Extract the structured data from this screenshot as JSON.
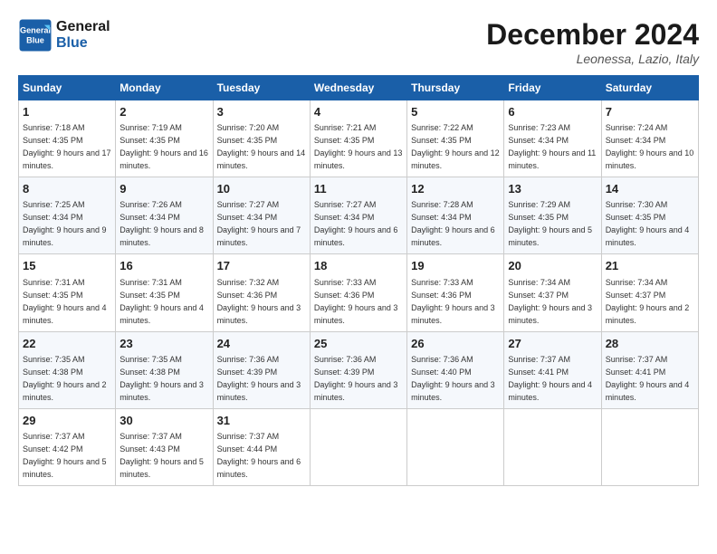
{
  "logo": {
    "line1": "General",
    "line2": "Blue"
  },
  "title": "December 2024",
  "location": "Leonessa, Lazio, Italy",
  "days_of_week": [
    "Sunday",
    "Monday",
    "Tuesday",
    "Wednesday",
    "Thursday",
    "Friday",
    "Saturday"
  ],
  "weeks": [
    [
      {
        "day": "1",
        "sunrise": "7:18 AM",
        "sunset": "4:35 PM",
        "daylight": "9 hours and 17 minutes."
      },
      {
        "day": "2",
        "sunrise": "7:19 AM",
        "sunset": "4:35 PM",
        "daylight": "9 hours and 16 minutes."
      },
      {
        "day": "3",
        "sunrise": "7:20 AM",
        "sunset": "4:35 PM",
        "daylight": "9 hours and 14 minutes."
      },
      {
        "day": "4",
        "sunrise": "7:21 AM",
        "sunset": "4:35 PM",
        "daylight": "9 hours and 13 minutes."
      },
      {
        "day": "5",
        "sunrise": "7:22 AM",
        "sunset": "4:35 PM",
        "daylight": "9 hours and 12 minutes."
      },
      {
        "day": "6",
        "sunrise": "7:23 AM",
        "sunset": "4:34 PM",
        "daylight": "9 hours and 11 minutes."
      },
      {
        "day": "7",
        "sunrise": "7:24 AM",
        "sunset": "4:34 PM",
        "daylight": "9 hours and 10 minutes."
      }
    ],
    [
      {
        "day": "8",
        "sunrise": "7:25 AM",
        "sunset": "4:34 PM",
        "daylight": "9 hours and 9 minutes."
      },
      {
        "day": "9",
        "sunrise": "7:26 AM",
        "sunset": "4:34 PM",
        "daylight": "9 hours and 8 minutes."
      },
      {
        "day": "10",
        "sunrise": "7:27 AM",
        "sunset": "4:34 PM",
        "daylight": "9 hours and 7 minutes."
      },
      {
        "day": "11",
        "sunrise": "7:27 AM",
        "sunset": "4:34 PM",
        "daylight": "9 hours and 6 minutes."
      },
      {
        "day": "12",
        "sunrise": "7:28 AM",
        "sunset": "4:34 PM",
        "daylight": "9 hours and 6 minutes."
      },
      {
        "day": "13",
        "sunrise": "7:29 AM",
        "sunset": "4:35 PM",
        "daylight": "9 hours and 5 minutes."
      },
      {
        "day": "14",
        "sunrise": "7:30 AM",
        "sunset": "4:35 PM",
        "daylight": "9 hours and 4 minutes."
      }
    ],
    [
      {
        "day": "15",
        "sunrise": "7:31 AM",
        "sunset": "4:35 PM",
        "daylight": "9 hours and 4 minutes."
      },
      {
        "day": "16",
        "sunrise": "7:31 AM",
        "sunset": "4:35 PM",
        "daylight": "9 hours and 4 minutes."
      },
      {
        "day": "17",
        "sunrise": "7:32 AM",
        "sunset": "4:36 PM",
        "daylight": "9 hours and 3 minutes."
      },
      {
        "day": "18",
        "sunrise": "7:33 AM",
        "sunset": "4:36 PM",
        "daylight": "9 hours and 3 minutes."
      },
      {
        "day": "19",
        "sunrise": "7:33 AM",
        "sunset": "4:36 PM",
        "daylight": "9 hours and 3 minutes."
      },
      {
        "day": "20",
        "sunrise": "7:34 AM",
        "sunset": "4:37 PM",
        "daylight": "9 hours and 3 minutes."
      },
      {
        "day": "21",
        "sunrise": "7:34 AM",
        "sunset": "4:37 PM",
        "daylight": "9 hours and 2 minutes."
      }
    ],
    [
      {
        "day": "22",
        "sunrise": "7:35 AM",
        "sunset": "4:38 PM",
        "daylight": "9 hours and 2 minutes."
      },
      {
        "day": "23",
        "sunrise": "7:35 AM",
        "sunset": "4:38 PM",
        "daylight": "9 hours and 3 minutes."
      },
      {
        "day": "24",
        "sunrise": "7:36 AM",
        "sunset": "4:39 PM",
        "daylight": "9 hours and 3 minutes."
      },
      {
        "day": "25",
        "sunrise": "7:36 AM",
        "sunset": "4:39 PM",
        "daylight": "9 hours and 3 minutes."
      },
      {
        "day": "26",
        "sunrise": "7:36 AM",
        "sunset": "4:40 PM",
        "daylight": "9 hours and 3 minutes."
      },
      {
        "day": "27",
        "sunrise": "7:37 AM",
        "sunset": "4:41 PM",
        "daylight": "9 hours and 4 minutes."
      },
      {
        "day": "28",
        "sunrise": "7:37 AM",
        "sunset": "4:41 PM",
        "daylight": "9 hours and 4 minutes."
      }
    ],
    [
      {
        "day": "29",
        "sunrise": "7:37 AM",
        "sunset": "4:42 PM",
        "daylight": "9 hours and 5 minutes."
      },
      {
        "day": "30",
        "sunrise": "7:37 AM",
        "sunset": "4:43 PM",
        "daylight": "9 hours and 5 minutes."
      },
      {
        "day": "31",
        "sunrise": "7:37 AM",
        "sunset": "4:44 PM",
        "daylight": "9 hours and 6 minutes."
      },
      null,
      null,
      null,
      null
    ]
  ]
}
